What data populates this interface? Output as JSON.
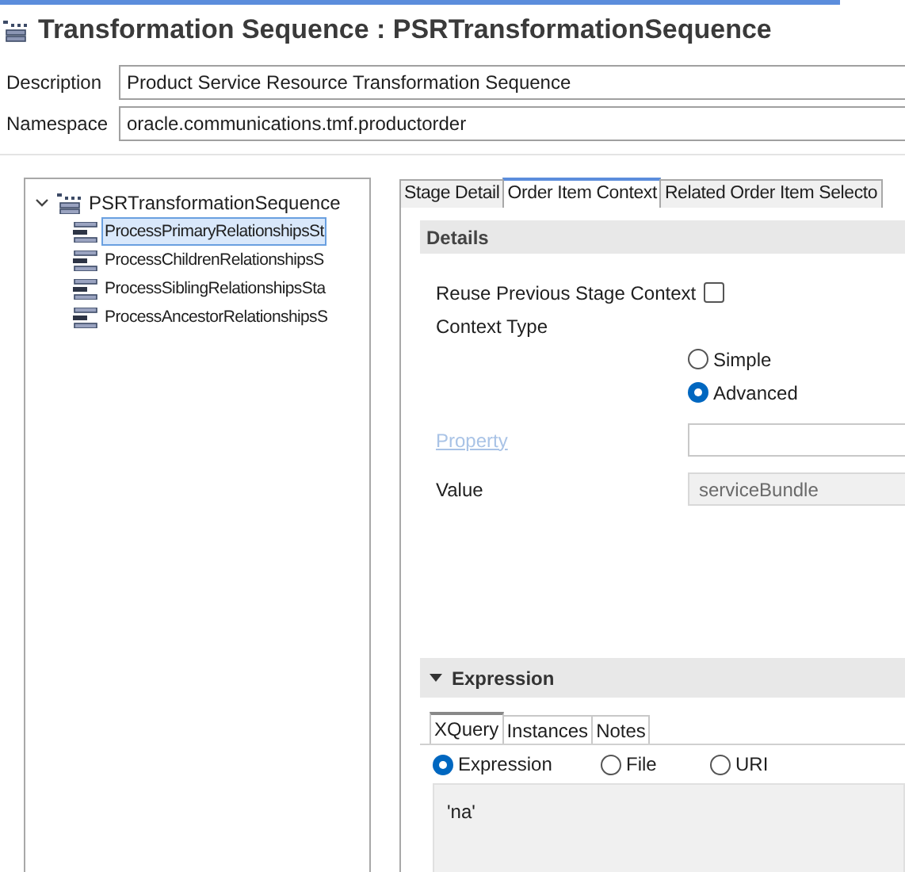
{
  "editor": {
    "title": "Transformation Sequence : PSRTransformationSequence"
  },
  "fields": [
    {
      "label": "Description",
      "value": "Product Service Resource Transformation Sequence"
    },
    {
      "label": "Namespace",
      "value": "oracle.communications.tmf.productorder"
    }
  ],
  "tree": {
    "label": "PSRTransformationSequence",
    "expanded": true,
    "children": [
      {
        "label": "ProcessPrimaryRelationshipsSt",
        "selected": true
      },
      {
        "label": "ProcessChildrenRelationshipsS",
        "selected": false
      },
      {
        "label": "ProcessSiblingRelationshipsSta",
        "selected": false
      },
      {
        "label": "ProcessAncestorRelationshipsS",
        "selected": false
      }
    ]
  },
  "tabs": [
    {
      "label": "Stage Detail",
      "selected": false
    },
    {
      "label": "Order Item Context",
      "selected": true
    },
    {
      "label": "Related Order Item Selecto",
      "selected": false
    }
  ],
  "details": {
    "title": "Details",
    "reuse_previous": {
      "label": "Reuse Previous Stage Context",
      "checked": false
    },
    "context_type": {
      "label": "Context Type",
      "options": [
        {
          "label": "Simple",
          "selected": false
        },
        {
          "label": "Advanced",
          "selected": true
        }
      ]
    },
    "property": {
      "label": "Property",
      "disabled": true
    },
    "value": {
      "label": "Value",
      "value": "serviceBundle",
      "disabled": true
    }
  },
  "expression": {
    "title": "Expression",
    "expanded": true,
    "tabs": [
      {
        "label": "XQuery",
        "selected": true
      },
      {
        "label": "Instances",
        "selected": false
      },
      {
        "label": "Notes",
        "selected": false
      }
    ],
    "sources": [
      {
        "label": "Expression",
        "selected": true
      },
      {
        "label": "File",
        "selected": false
      },
      {
        "label": "URI",
        "selected": false
      }
    ],
    "text": "'na'"
  }
}
